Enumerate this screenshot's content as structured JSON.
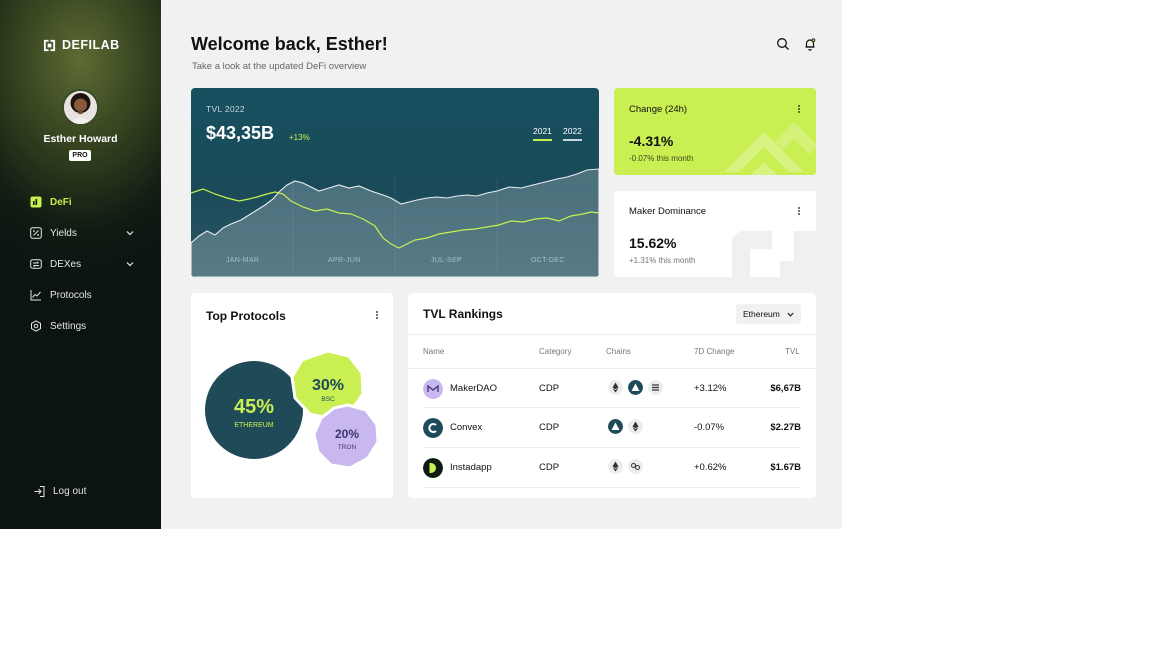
{
  "brand": {
    "name": "DEFILAB"
  },
  "user": {
    "name": "Esther Howard",
    "badge": "PRO"
  },
  "nav": {
    "items": [
      {
        "label": "DeFi",
        "icon": "bar-chart-icon",
        "active": true
      },
      {
        "label": "Yields",
        "icon": "percent-icon",
        "expandable": true
      },
      {
        "label": "DEXes",
        "icon": "exchange-icon",
        "expandable": true
      },
      {
        "label": "Protocols",
        "icon": "line-chart-icon"
      },
      {
        "label": "Settings",
        "icon": "gear-icon"
      }
    ],
    "logout": "Log out"
  },
  "header": {
    "title": "Welcome back, Esther!",
    "subtitle": "Take a look at the updated DeFi overview"
  },
  "tvl": {
    "label": "TVL 2022",
    "value": "$43,35B",
    "change": "+13%",
    "years": [
      "2021",
      "2022"
    ],
    "quarters": [
      "JAN-MAR",
      "APR-JUN",
      "JUL-SEP",
      "OCT-DEC"
    ]
  },
  "change_card": {
    "title": "Change (24h)",
    "value": "-4.31%",
    "note": "-0.07% this month"
  },
  "maker_card": {
    "title": "Maker Dominance",
    "value": "15.62%",
    "note": "+1.31% this month"
  },
  "protocols": {
    "title": "Top Protocols",
    "items": [
      {
        "pct": "45%",
        "name": "ETHEREUM",
        "color": "#1f4a58"
      },
      {
        "pct": "30%",
        "name": "BSC",
        "color": "#c9ef52"
      },
      {
        "pct": "20%",
        "name": "TRON",
        "color": "#c9b8ef"
      }
    ]
  },
  "rankings": {
    "title": "TVL Rankings",
    "filter": "Ethereum",
    "columns": [
      "Name",
      "Category",
      "Chains",
      "7D Change",
      "TVL"
    ],
    "rows": [
      {
        "name": "MakerDAO",
        "category": "CDP",
        "change": "+3.12%",
        "tvl": "$6,67B"
      },
      {
        "name": "Convex",
        "category": "CDP",
        "change": "-0.07%",
        "tvl": "$2.27B"
      },
      {
        "name": "Instadapp",
        "category": "CDP",
        "change": "+0.62%",
        "tvl": "$1.67B"
      }
    ]
  },
  "colors": {
    "accent": "#c9ef52",
    "dark_teal": "#1f4a58",
    "lavender": "#c9b8ef"
  }
}
